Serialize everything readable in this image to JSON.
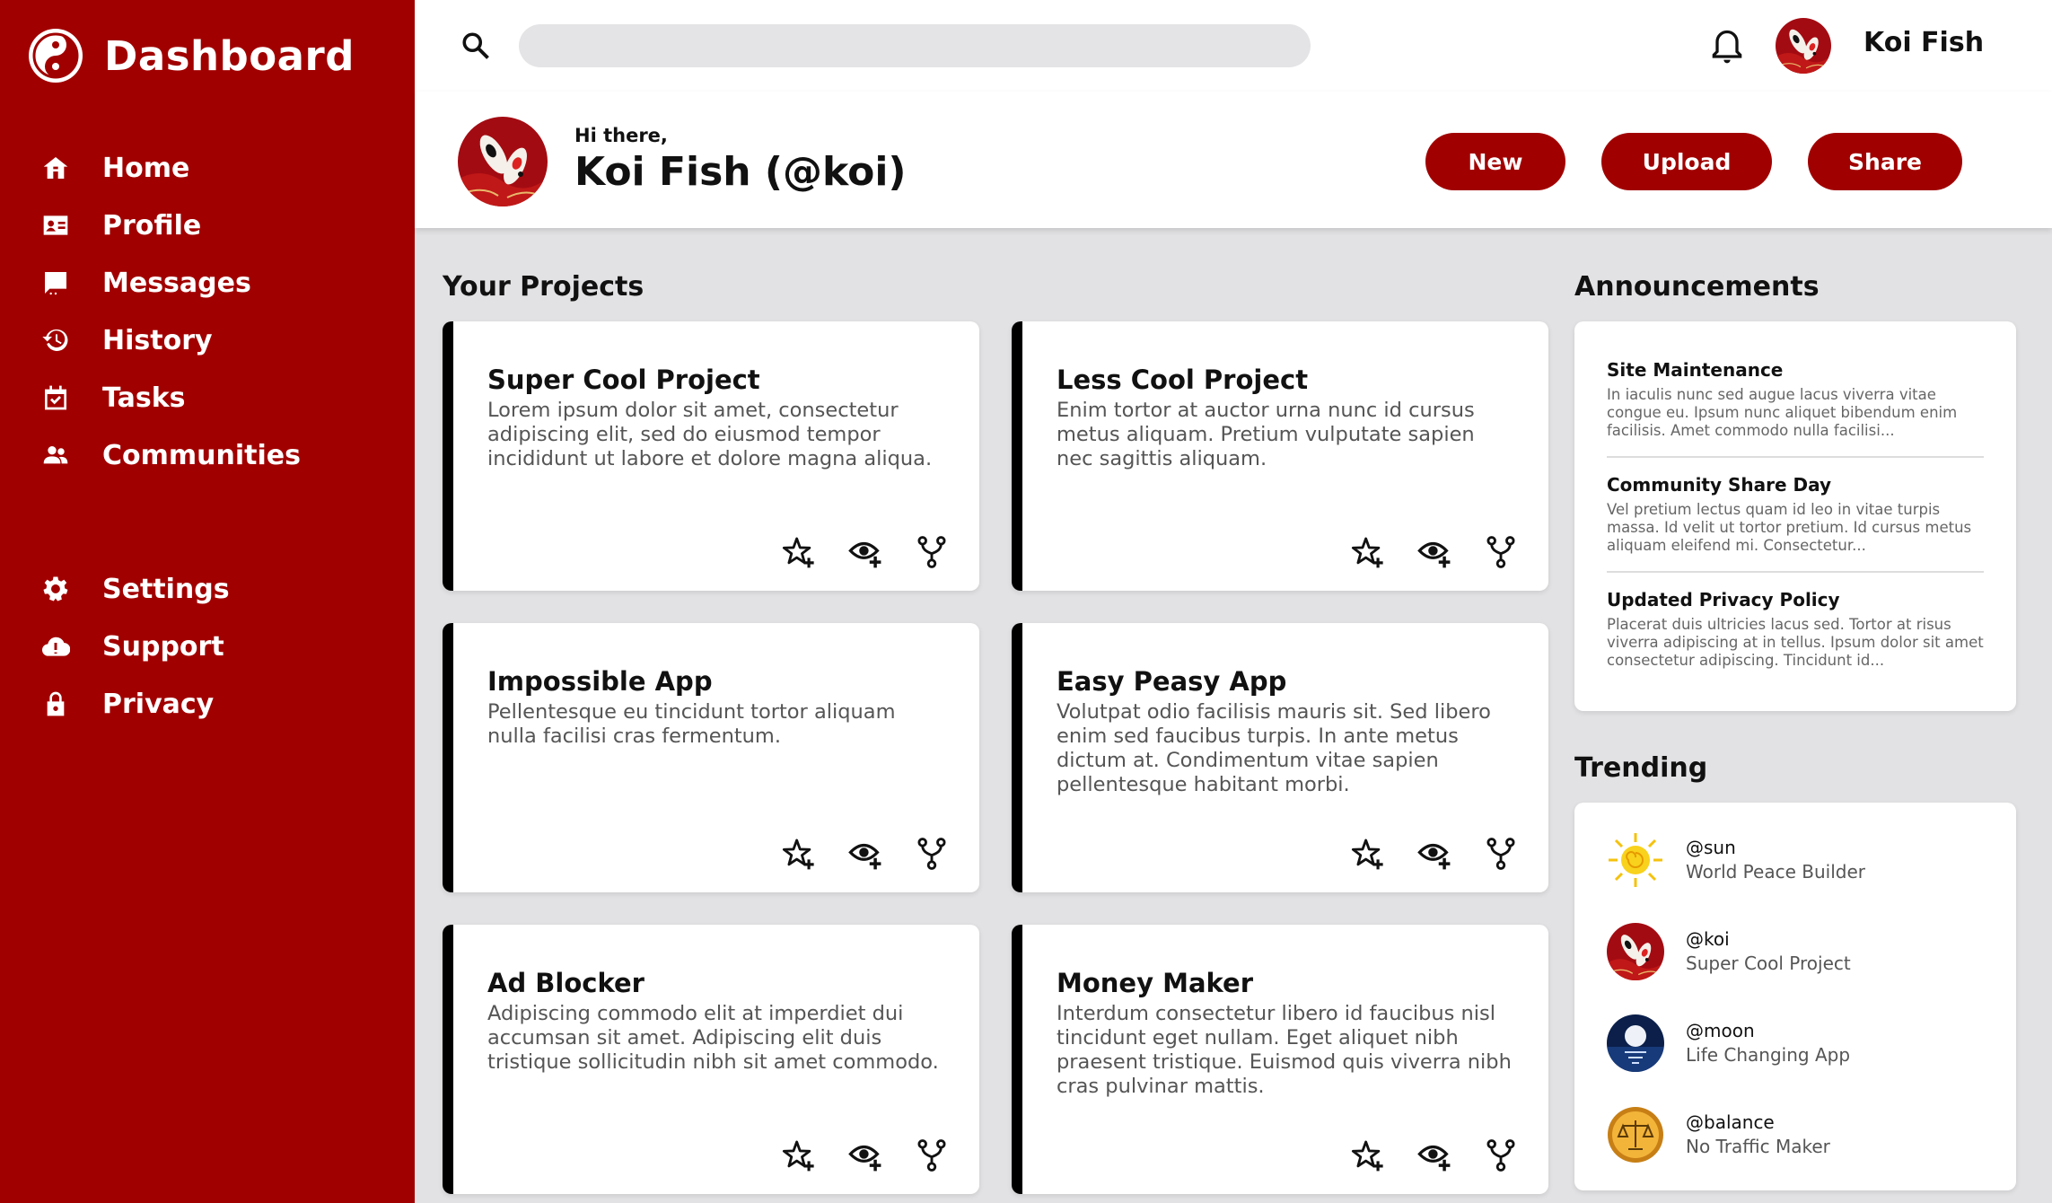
{
  "sidebar": {
    "brand": "Dashboard",
    "nav_main": [
      {
        "label": "Home",
        "icon": "home-icon"
      },
      {
        "label": "Profile",
        "icon": "profile-card-icon"
      },
      {
        "label": "Messages",
        "icon": "message-icon"
      },
      {
        "label": "History",
        "icon": "history-icon"
      },
      {
        "label": "Tasks",
        "icon": "tasks-icon"
      },
      {
        "label": "Communities",
        "icon": "communities-icon"
      }
    ],
    "nav_secondary": [
      {
        "label": "Settings",
        "icon": "gear-icon"
      },
      {
        "label": "Support",
        "icon": "support-icon"
      },
      {
        "label": "Privacy",
        "icon": "lock-icon"
      }
    ]
  },
  "topbar": {
    "search_placeholder": "",
    "user_name": "Koi Fish"
  },
  "header": {
    "greeting": "Hi there,",
    "profile_name": "Koi Fish (@koi)",
    "buttons": {
      "new": "New",
      "upload": "Upload",
      "share": "Share"
    }
  },
  "projects": {
    "title": "Your Projects",
    "items": [
      {
        "title": "Super Cool Project",
        "desc": "Lorem ipsum dolor sit amet, consectetur adipiscing elit, sed do eiusmod tempor incididunt ut labore et dolore magna aliqua."
      },
      {
        "title": "Less Cool Project",
        "desc": "Enim tortor at auctor urna nunc id cursus metus aliquam. Pretium vulputate sapien nec sagittis aliquam."
      },
      {
        "title": "Impossible App",
        "desc": "Pellentesque eu tincidunt tortor aliquam nulla facilisi cras fermentum."
      },
      {
        "title": "Easy Peasy App",
        "desc": "Volutpat odio facilisis mauris sit. Sed libero enim sed faucibus turpis. In ante metus dictum at. Condimentum vitae sapien pellentesque habitant morbi."
      },
      {
        "title": "Ad Blocker",
        "desc": "Adipiscing commodo elit at imperdiet dui accumsan sit amet. Adipiscing elit duis tristique sollicitudin nibh sit amet commodo."
      },
      {
        "title": "Money Maker",
        "desc": "Interdum consectetur libero id faucibus nisl tincidunt eget nullam. Eget aliquet nibh praesent tristique. Euismod quis viverra nibh cras pulvinar mattis."
      }
    ]
  },
  "announcements": {
    "title": "Announcements",
    "items": [
      {
        "title": "Site Maintenance",
        "body": "In iaculis nunc sed augue lacus viverra vitae congue eu. Ipsum nunc aliquet bibendum enim facilisis. Amet commodo nulla facilisi..."
      },
      {
        "title": "Community Share Day",
        "body": "Vel pretium lectus quam id leo in vitae turpis massa. Id velit ut tortor pretium. Id cursus metus aliquam eleifend mi. Consectetur..."
      },
      {
        "title": "Updated Privacy Policy",
        "body": "Placerat duis ultricies lacus sed. Tortor at risus viverra adipiscing at in tellus. Ipsum dolor sit amet consectetur adipiscing. Tincidunt id..."
      }
    ]
  },
  "trending": {
    "title": "Trending",
    "items": [
      {
        "handle": "@sun",
        "sub": "World Peace Builder",
        "icon": "sun-avatar"
      },
      {
        "handle": "@koi",
        "sub": "Super Cool Project",
        "icon": "koi-avatar"
      },
      {
        "handle": "@moon",
        "sub": "Life Changing App",
        "icon": "moon-avatar"
      },
      {
        "handle": "@balance",
        "sub": "No Traffic Maker",
        "icon": "balance-avatar"
      }
    ]
  },
  "colors": {
    "brand": "#a10000",
    "background": "#e2e2e4",
    "card": "#ffffff"
  }
}
